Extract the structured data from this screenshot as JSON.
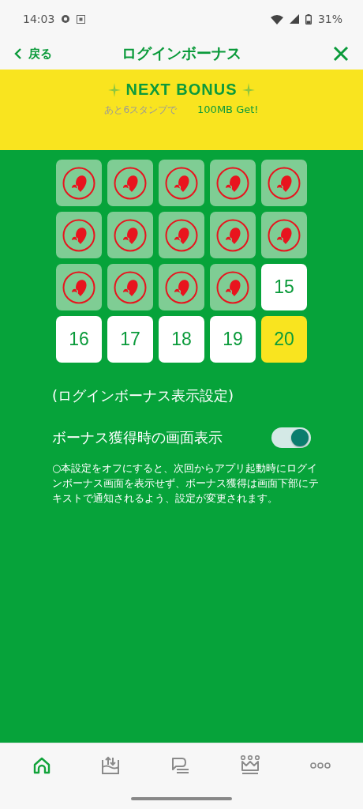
{
  "status_bar": {
    "time": "14:03",
    "battery": "31%"
  },
  "header": {
    "back": "戻る",
    "title": "ログインボーナス"
  },
  "next_bonus": {
    "title": "NEXT BONUS",
    "remaining": "あと6スタンプで",
    "reward": "100MB Get!"
  },
  "stamps": [
    {
      "kind": "stamped"
    },
    {
      "kind": "stamped"
    },
    {
      "kind": "stamped"
    },
    {
      "kind": "stamped"
    },
    {
      "kind": "stamped"
    },
    {
      "kind": "stamped"
    },
    {
      "kind": "stamped"
    },
    {
      "kind": "stamped"
    },
    {
      "kind": "stamped"
    },
    {
      "kind": "stamped"
    },
    {
      "kind": "stamped"
    },
    {
      "kind": "stamped"
    },
    {
      "kind": "stamped"
    },
    {
      "kind": "stamped"
    },
    {
      "kind": "open",
      "label": "15"
    },
    {
      "kind": "open",
      "label": "16"
    },
    {
      "kind": "open",
      "label": "17"
    },
    {
      "kind": "open",
      "label": "18"
    },
    {
      "kind": "open",
      "label": "19"
    },
    {
      "kind": "goal",
      "label": "20"
    }
  ],
  "settings": {
    "heading": "(ログインボーナス表示設定)",
    "toggle_label": "ボーナス獲得時の画面表示",
    "on": true,
    "note": "○本設定をオフにすると、次回からアプリ起動時にログインボーナス画面を表示せず、ボーナス獲得は画面下部にテキストで通知されるよう、設定が変更されます。"
  },
  "bottom_nav": [
    {
      "kind": "home",
      "selected": true
    },
    {
      "kind": "transfer",
      "selected": false
    },
    {
      "kind": "chat",
      "selected": false
    },
    {
      "kind": "crown",
      "selected": false
    },
    {
      "kind": "more",
      "selected": false
    }
  ]
}
